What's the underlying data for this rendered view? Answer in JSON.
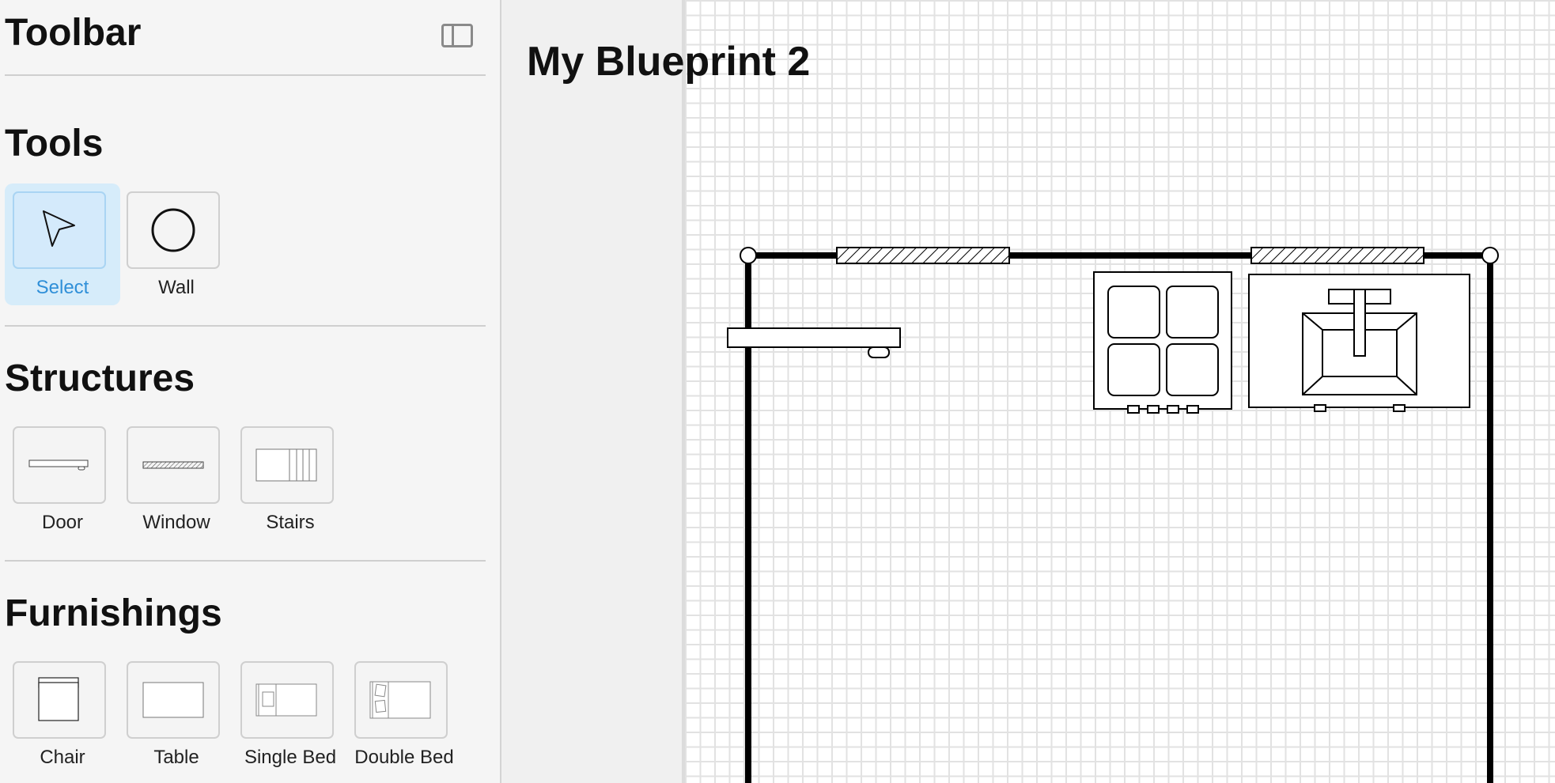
{
  "sidebar": {
    "title": "Toolbar",
    "sections": {
      "tools": {
        "title": "Tools",
        "items": [
          {
            "label": "Select",
            "icon": "cursor-arrow-icon",
            "active": true
          },
          {
            "label": "Wall",
            "icon": "circle-icon",
            "active": false
          }
        ]
      },
      "structures": {
        "title": "Structures",
        "items": [
          {
            "label": "Door",
            "icon": "door-icon"
          },
          {
            "label": "Window",
            "icon": "window-icon"
          },
          {
            "label": "Stairs",
            "icon": "stairs-icon"
          }
        ]
      },
      "furnishings": {
        "title": "Furnishings",
        "items": [
          {
            "label": "Chair",
            "icon": "chair-icon"
          },
          {
            "label": "Table",
            "icon": "table-icon"
          },
          {
            "label": "Single Bed",
            "icon": "single-bed-icon"
          },
          {
            "label": "Double Bed",
            "icon": "double-bed-icon"
          }
        ]
      }
    }
  },
  "document": {
    "title": "My Blueprint 2"
  },
  "colors": {
    "active_accent": "#2f8fd8",
    "active_bg": "#d6ecfa",
    "wall": "#000000",
    "grid": "#e2e2e2"
  }
}
